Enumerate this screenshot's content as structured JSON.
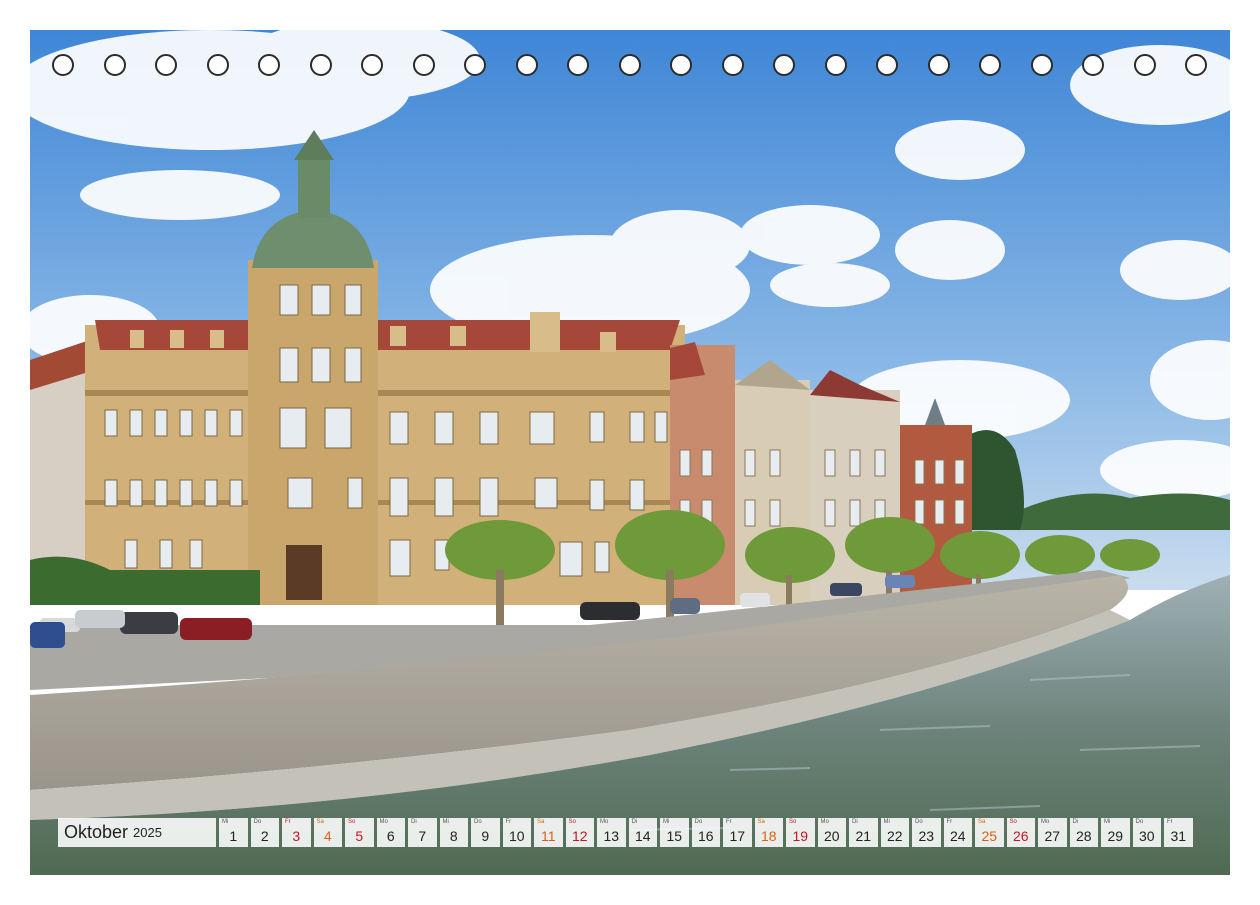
{
  "calendar": {
    "month": "Oktober",
    "year": "2025",
    "days": [
      {
        "d": "1",
        "w": "Mi",
        "t": "wd"
      },
      {
        "d": "2",
        "w": "Do",
        "t": "wd"
      },
      {
        "d": "3",
        "w": "Fr",
        "t": "sun"
      },
      {
        "d": "4",
        "w": "Sa",
        "t": "sat"
      },
      {
        "d": "5",
        "w": "So",
        "t": "sun"
      },
      {
        "d": "6",
        "w": "Mo",
        "t": "wd"
      },
      {
        "d": "7",
        "w": "Di",
        "t": "wd"
      },
      {
        "d": "8",
        "w": "Mi",
        "t": "wd"
      },
      {
        "d": "9",
        "w": "Do",
        "t": "wd"
      },
      {
        "d": "10",
        "w": "Fr",
        "t": "wd"
      },
      {
        "d": "11",
        "w": "Sa",
        "t": "sat"
      },
      {
        "d": "12",
        "w": "So",
        "t": "sun"
      },
      {
        "d": "13",
        "w": "Mo",
        "t": "wd"
      },
      {
        "d": "14",
        "w": "Di",
        "t": "wd"
      },
      {
        "d": "15",
        "w": "Mi",
        "t": "wd"
      },
      {
        "d": "16",
        "w": "Do",
        "t": "wd"
      },
      {
        "d": "17",
        "w": "Fr",
        "t": "wd"
      },
      {
        "d": "18",
        "w": "Sa",
        "t": "sat"
      },
      {
        "d": "19",
        "w": "So",
        "t": "sun"
      },
      {
        "d": "20",
        "w": "Mo",
        "t": "wd"
      },
      {
        "d": "21",
        "w": "Di",
        "t": "wd"
      },
      {
        "d": "22",
        "w": "Mi",
        "t": "wd"
      },
      {
        "d": "23",
        "w": "Do",
        "t": "wd"
      },
      {
        "d": "24",
        "w": "Fr",
        "t": "wd"
      },
      {
        "d": "25",
        "w": "Sa",
        "t": "sat"
      },
      {
        "d": "26",
        "w": "So",
        "t": "sun"
      },
      {
        "d": "27",
        "w": "Mo",
        "t": "wd"
      },
      {
        "d": "28",
        "w": "Di",
        "t": "wd"
      },
      {
        "d": "29",
        "w": "Mi",
        "t": "wd"
      },
      {
        "d": "30",
        "w": "Do",
        "t": "wd"
      },
      {
        "d": "31",
        "w": "Fr",
        "t": "wd"
      }
    ]
  },
  "binding": {
    "hole_count": 23
  },
  "colors": {
    "saturday": "#d9601a",
    "sunday": "#c0162a",
    "sky": "#4a8fd8",
    "water": "#6f8478",
    "sandstone": "#c9a46a"
  }
}
